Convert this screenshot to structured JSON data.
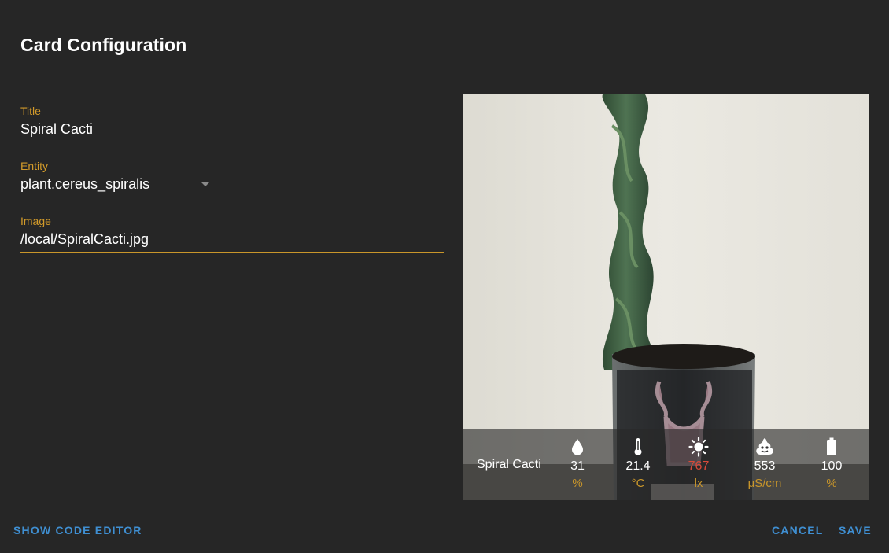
{
  "dialog": {
    "title": "Card Configuration"
  },
  "form": {
    "title": {
      "label": "Title",
      "value": "Spiral Cacti"
    },
    "entity": {
      "label": "Entity",
      "value": "plant.cereus_spiralis"
    },
    "image": {
      "label": "Image",
      "value": "/local/SpiralCacti.jpg"
    }
  },
  "preview": {
    "name": "Spiral Cacti",
    "attributes": [
      {
        "icon": "water-drop-icon",
        "value": "31",
        "unit": "%"
      },
      {
        "icon": "thermometer-icon",
        "value": "21.4",
        "unit": "°C"
      },
      {
        "icon": "sun-icon",
        "value": "767",
        "unit": "lx",
        "color": "#d84a3a"
      },
      {
        "icon": "fertilizer-icon",
        "value": "553",
        "unit": "μS/cm"
      },
      {
        "icon": "battery-icon",
        "value": "100",
        "unit": "%"
      }
    ]
  },
  "footer": {
    "code_editor": "SHOW CODE EDITOR",
    "cancel": "CANCEL",
    "save": "SAVE"
  },
  "colors": {
    "accent": "#c9962a",
    "button": "#3f8fd2",
    "background": "#262626",
    "warning": "#d84a3a"
  }
}
